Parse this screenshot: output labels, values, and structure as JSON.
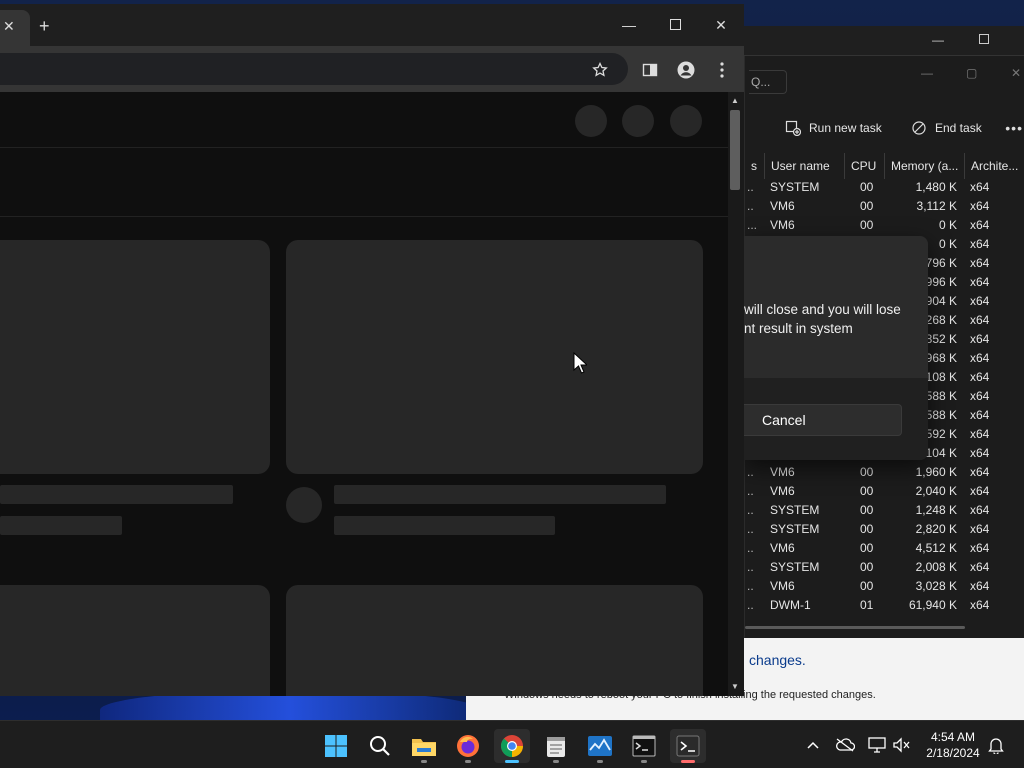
{
  "update_window": {
    "link_text": "changes.",
    "message": "Windows needs to reboot your PC to finish installing the requested changes."
  },
  "task_manager": {
    "search_fragment": "Q...",
    "toolbar": {
      "run_new_task": "Run new task",
      "end_task": "End task"
    },
    "columns": {
      "status_fragment": "s",
      "user_name": "User name",
      "cpu": "CPU",
      "memory": "Memory (a...",
      "architecture": "Archite..."
    },
    "rows": [
      {
        "cut": "..",
        "user": "SYSTEM",
        "cpu": "00",
        "mem": "1,480 K",
        "arch": "x64"
      },
      {
        "cut": "..",
        "user": "VM6",
        "cpu": "00",
        "mem": "3,112 K",
        "arch": "x64"
      },
      {
        "cut": "...",
        "user": "VM6",
        "cpu": "00",
        "mem": "0 K",
        "arch": "x64"
      },
      {
        "cut": "",
        "user": "",
        "cpu": "",
        "mem": "0 K",
        "arch": "x64"
      },
      {
        "cut": "",
        "user": "",
        "cpu": "",
        "mem": "796 K",
        "arch": "x64"
      },
      {
        "cut": "",
        "user": "",
        "cpu": "",
        "mem": "996 K",
        "arch": "x64"
      },
      {
        "cut": "",
        "user": "",
        "cpu": "",
        "mem": "904 K",
        "arch": "x64"
      },
      {
        "cut": "",
        "user": "",
        "cpu": "",
        "mem": "268 K",
        "arch": "x64"
      },
      {
        "cut": "",
        "user": "",
        "cpu": "",
        "mem": "852 K",
        "arch": "x64"
      },
      {
        "cut": "",
        "user": "",
        "cpu": "",
        "mem": "968 K",
        "arch": "x64"
      },
      {
        "cut": "",
        "user": "",
        "cpu": "",
        "mem": "108 K",
        "arch": "x64"
      },
      {
        "cut": "",
        "user": "",
        "cpu": "",
        "mem": "588 K",
        "arch": "x64"
      },
      {
        "cut": "",
        "user": "",
        "cpu": "",
        "mem": "588 K",
        "arch": "x64"
      },
      {
        "cut": "",
        "user": "",
        "cpu": "",
        "mem": "592 K",
        "arch": "x64"
      },
      {
        "cut": "",
        "user": "",
        "cpu": "",
        "mem": ",104 K",
        "arch": "x64"
      },
      {
        "cut": "..",
        "user": "VM6",
        "cpu": "00",
        "mem": "1,960 K",
        "arch": "x64"
      },
      {
        "cut": "..",
        "user": "VM6",
        "cpu": "00",
        "mem": "2,040 K",
        "arch": "x64"
      },
      {
        "cut": "..",
        "user": "SYSTEM",
        "cpu": "00",
        "mem": "1,248 K",
        "arch": "x64"
      },
      {
        "cut": "..",
        "user": "SYSTEM",
        "cpu": "00",
        "mem": "2,820 K",
        "arch": "x64"
      },
      {
        "cut": "..",
        "user": "VM6",
        "cpu": "00",
        "mem": "4,512 K",
        "arch": "x64"
      },
      {
        "cut": "..",
        "user": "SYSTEM",
        "cpu": "00",
        "mem": "2,008 K",
        "arch": "x64"
      },
      {
        "cut": "..",
        "user": "VM6",
        "cpu": "00",
        "mem": "3,028 K",
        "arch": "x64"
      },
      {
        "cut": "..",
        "user": "DWM-1",
        "cpu": "01",
        "mem": "61,940 K",
        "arch": "x64"
      }
    ]
  },
  "dialog": {
    "message_line1": "will close and you will lose",
    "message_line2": "nt result in system",
    "cancel_label": "Cancel"
  },
  "taskbar": {
    "time": "4:54 AM",
    "date": "2/18/2024"
  },
  "colors": {
    "accent": "#4cc2ff",
    "link": "#0a3b8c"
  }
}
